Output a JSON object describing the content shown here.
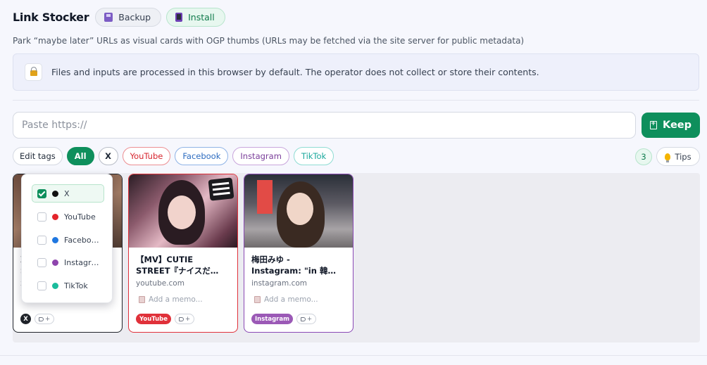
{
  "app": {
    "title": "Link Stocker",
    "backup_label": "Backup",
    "install_label": "Install",
    "subtitle": "Park “maybe later” URLs as visual cards with OGP thumbs (URLs may be fetched via the site server for public metadata)"
  },
  "notice": {
    "text": "Files and inputs are processed in this browser by default. The operator does not collect or store their contents.",
    "icon": "lock-icon"
  },
  "url_input": {
    "placeholder": "Paste https://",
    "value": ""
  },
  "keep_button": {
    "label": "Keep",
    "icon": "bookmark-plus-icon"
  },
  "filters": {
    "edit_tags_label": "Edit tags",
    "items": [
      {
        "label": "All",
        "active": true
      },
      {
        "label": "X",
        "color": "#1f2329"
      },
      {
        "label": "YouTube",
        "color": "#d6252e"
      },
      {
        "label": "Facebook",
        "color": "#2d6cc0"
      },
      {
        "label": "Instagram",
        "color": "#7a3e9a"
      },
      {
        "label": "TikTok",
        "color": "#1aa89c"
      }
    ]
  },
  "count": "3",
  "tips_label": "Tips",
  "tag_menu": {
    "items": [
      {
        "label": "X",
        "checked": true,
        "color": "#111111"
      },
      {
        "label": "YouTube",
        "checked": false,
        "color": "#e3242b"
      },
      {
        "label": "Facebook",
        "checked": false,
        "color": "#1f77e0"
      },
      {
        "label": "Instagram",
        "checked": false,
        "color": "#8e44ad"
      },
      {
        "label": "TikTok",
        "checked": false,
        "color": "#1abc9c"
      }
    ]
  },
  "cards": [
    {
      "title": "X\nS",
      "domain": "x",
      "memo_placeholder": "",
      "tag": "X",
      "tag_add": "+"
    },
    {
      "title": "【MV】CUTIE\nSTREET『ナイスだ…",
      "domain": "youtube.com",
      "memo_placeholder": "Add a memo...",
      "tag": "YouTube",
      "tag_add": "+"
    },
    {
      "title": "梅田みゆ -\nInstagram: \"in 韓…",
      "domain": "instagram.com",
      "memo_placeholder": "Add a memo...",
      "tag": "Instagram",
      "tag_add": "+"
    }
  ]
}
